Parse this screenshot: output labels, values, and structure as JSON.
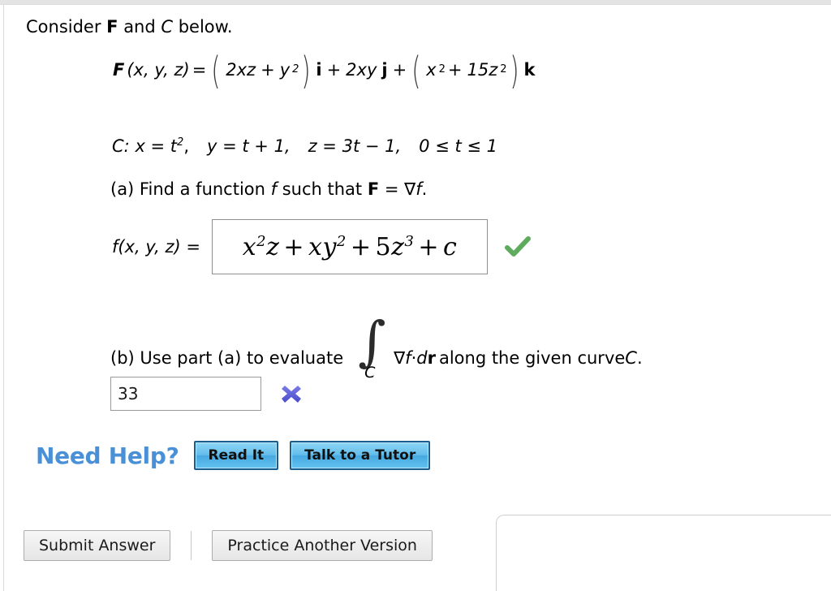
{
  "problem": {
    "intro_prefix": "Consider ",
    "intro_vector": "F",
    "intro_mid": " and ",
    "intro_curve": "C",
    "intro_suffix": " below."
  },
  "field_equation": {
    "lhs_bold": "F",
    "lhs_args": "(x, y, z)",
    "equals": "=",
    "group1_term1": "2xz",
    "group1_plus": "+",
    "group1_term2": "y",
    "group1_exp2": "2",
    "unit_i": "i",
    "plus1": "+",
    "term_j_coef": "2xy",
    "unit_j": "j",
    "plus2": "+",
    "group2_term1": "x",
    "group2_exp1": "2",
    "group2_plus": "+",
    "group2_term2": "15z",
    "group2_exp2": "2",
    "unit_k": "k",
    "paren_open": "(",
    "paren_close": ")"
  },
  "curve_equation": {
    "label": "C:",
    "x_def": "x = t",
    "x_exp": "2",
    "x_comma": ",",
    "y_def": "y = t + 1,",
    "z_def": "z = 3t − 1,",
    "domain": "0 ≤ t ≤ 1"
  },
  "part_a": {
    "prompt_prefix": "(a) Find a function ",
    "prompt_f": "f",
    "prompt_mid": " such that ",
    "prompt_F": "F",
    "prompt_eq": " = ",
    "prompt_grad": "∇f",
    "prompt_period": ".",
    "answer_label_f": "f",
    "answer_label_args": "(x, y, z)  =",
    "answer": {
      "t1_base": "x",
      "t1_exp": "2",
      "t1_tail": "z",
      "op1": "+",
      "t2_base": "xy",
      "t2_exp": "2",
      "op2": "+",
      "t3_coef": "5",
      "t3_base": "z",
      "t3_exp": "3",
      "op3": "+",
      "t4": "c"
    },
    "status_icon": "green-check-icon",
    "status_color": "#5eab5e"
  },
  "part_b": {
    "prompt_prefix": "(b) Use part (a) to evaluate",
    "integral_sign": "∫",
    "integral_sub": "C",
    "integrand_grad": "∇f",
    "integrand_dot": " · ",
    "integrand_d": "d",
    "integrand_r": "r",
    "prompt_suffix": "along the given curve ",
    "prompt_curve": "C",
    "prompt_period": ".",
    "answer_value": "33",
    "answer_placeholder": "",
    "status_icon": "blue-x-icon",
    "status_color": "#5a5ad6"
  },
  "help": {
    "label": "Need Help?",
    "buttons": [
      {
        "name": "read-it",
        "label": "Read It"
      },
      {
        "name": "talk-to-a-tutor",
        "label": "Talk to a Tutor"
      }
    ],
    "label_color": "#4a90d6"
  },
  "footer": {
    "submit_label": "Submit Answer",
    "practice_label": "Practice Another Version"
  }
}
